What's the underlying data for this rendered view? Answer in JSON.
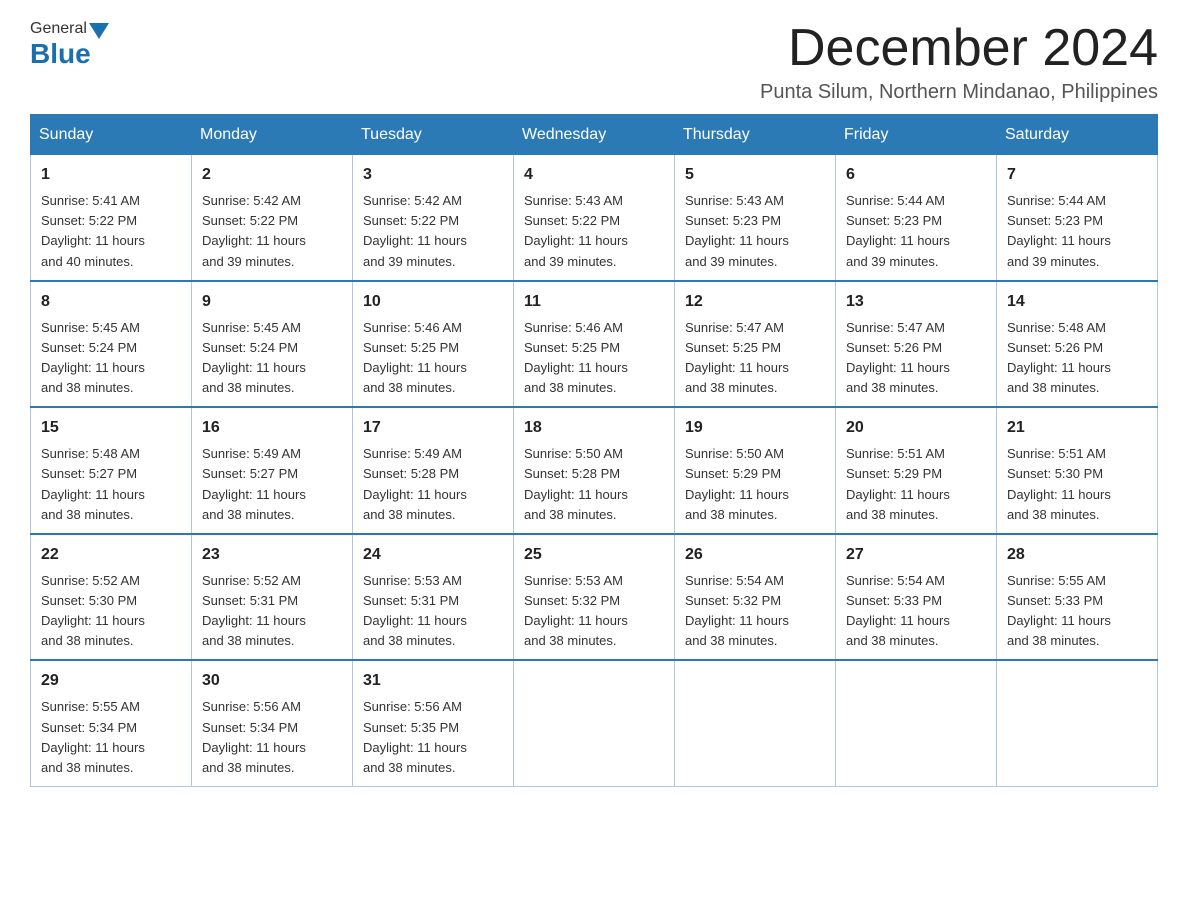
{
  "header": {
    "logo_general": "General",
    "logo_blue": "Blue",
    "month_title": "December 2024",
    "location": "Punta Silum, Northern Mindanao, Philippines"
  },
  "days_of_week": [
    "Sunday",
    "Monday",
    "Tuesday",
    "Wednesday",
    "Thursday",
    "Friday",
    "Saturday"
  ],
  "weeks": [
    [
      {
        "day": "1",
        "sunrise": "5:41 AM",
        "sunset": "5:22 PM",
        "daylight": "11 hours and 40 minutes."
      },
      {
        "day": "2",
        "sunrise": "5:42 AM",
        "sunset": "5:22 PM",
        "daylight": "11 hours and 39 minutes."
      },
      {
        "day": "3",
        "sunrise": "5:42 AM",
        "sunset": "5:22 PM",
        "daylight": "11 hours and 39 minutes."
      },
      {
        "day": "4",
        "sunrise": "5:43 AM",
        "sunset": "5:22 PM",
        "daylight": "11 hours and 39 minutes."
      },
      {
        "day": "5",
        "sunrise": "5:43 AM",
        "sunset": "5:23 PM",
        "daylight": "11 hours and 39 minutes."
      },
      {
        "day": "6",
        "sunrise": "5:44 AM",
        "sunset": "5:23 PM",
        "daylight": "11 hours and 39 minutes."
      },
      {
        "day": "7",
        "sunrise": "5:44 AM",
        "sunset": "5:23 PM",
        "daylight": "11 hours and 39 minutes."
      }
    ],
    [
      {
        "day": "8",
        "sunrise": "5:45 AM",
        "sunset": "5:24 PM",
        "daylight": "11 hours and 38 minutes."
      },
      {
        "day": "9",
        "sunrise": "5:45 AM",
        "sunset": "5:24 PM",
        "daylight": "11 hours and 38 minutes."
      },
      {
        "day": "10",
        "sunrise": "5:46 AM",
        "sunset": "5:25 PM",
        "daylight": "11 hours and 38 minutes."
      },
      {
        "day": "11",
        "sunrise": "5:46 AM",
        "sunset": "5:25 PM",
        "daylight": "11 hours and 38 minutes."
      },
      {
        "day": "12",
        "sunrise": "5:47 AM",
        "sunset": "5:25 PM",
        "daylight": "11 hours and 38 minutes."
      },
      {
        "day": "13",
        "sunrise": "5:47 AM",
        "sunset": "5:26 PM",
        "daylight": "11 hours and 38 minutes."
      },
      {
        "day": "14",
        "sunrise": "5:48 AM",
        "sunset": "5:26 PM",
        "daylight": "11 hours and 38 minutes."
      }
    ],
    [
      {
        "day": "15",
        "sunrise": "5:48 AM",
        "sunset": "5:27 PM",
        "daylight": "11 hours and 38 minutes."
      },
      {
        "day": "16",
        "sunrise": "5:49 AM",
        "sunset": "5:27 PM",
        "daylight": "11 hours and 38 minutes."
      },
      {
        "day": "17",
        "sunrise": "5:49 AM",
        "sunset": "5:28 PM",
        "daylight": "11 hours and 38 minutes."
      },
      {
        "day": "18",
        "sunrise": "5:50 AM",
        "sunset": "5:28 PM",
        "daylight": "11 hours and 38 minutes."
      },
      {
        "day": "19",
        "sunrise": "5:50 AM",
        "sunset": "5:29 PM",
        "daylight": "11 hours and 38 minutes."
      },
      {
        "day": "20",
        "sunrise": "5:51 AM",
        "sunset": "5:29 PM",
        "daylight": "11 hours and 38 minutes."
      },
      {
        "day": "21",
        "sunrise": "5:51 AM",
        "sunset": "5:30 PM",
        "daylight": "11 hours and 38 minutes."
      }
    ],
    [
      {
        "day": "22",
        "sunrise": "5:52 AM",
        "sunset": "5:30 PM",
        "daylight": "11 hours and 38 minutes."
      },
      {
        "day": "23",
        "sunrise": "5:52 AM",
        "sunset": "5:31 PM",
        "daylight": "11 hours and 38 minutes."
      },
      {
        "day": "24",
        "sunrise": "5:53 AM",
        "sunset": "5:31 PM",
        "daylight": "11 hours and 38 minutes."
      },
      {
        "day": "25",
        "sunrise": "5:53 AM",
        "sunset": "5:32 PM",
        "daylight": "11 hours and 38 minutes."
      },
      {
        "day": "26",
        "sunrise": "5:54 AM",
        "sunset": "5:32 PM",
        "daylight": "11 hours and 38 minutes."
      },
      {
        "day": "27",
        "sunrise": "5:54 AM",
        "sunset": "5:33 PM",
        "daylight": "11 hours and 38 minutes."
      },
      {
        "day": "28",
        "sunrise": "5:55 AM",
        "sunset": "5:33 PM",
        "daylight": "11 hours and 38 minutes."
      }
    ],
    [
      {
        "day": "29",
        "sunrise": "5:55 AM",
        "sunset": "5:34 PM",
        "daylight": "11 hours and 38 minutes."
      },
      {
        "day": "30",
        "sunrise": "5:56 AM",
        "sunset": "5:34 PM",
        "daylight": "11 hours and 38 minutes."
      },
      {
        "day": "31",
        "sunrise": "5:56 AM",
        "sunset": "5:35 PM",
        "daylight": "11 hours and 38 minutes."
      },
      null,
      null,
      null,
      null
    ]
  ],
  "labels": {
    "sunrise": "Sunrise:",
    "sunset": "Sunset:",
    "daylight": "Daylight:"
  }
}
